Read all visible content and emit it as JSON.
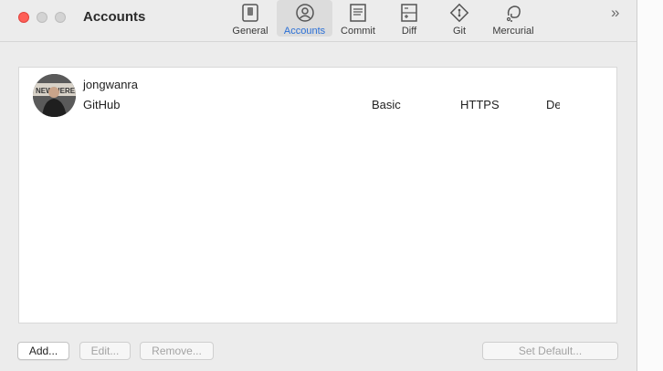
{
  "window": {
    "title": "Accounts"
  },
  "toolbar": {
    "items": [
      {
        "label": "General",
        "icon": "general-switch-icon"
      },
      {
        "label": "Accounts",
        "icon": "account-icon",
        "active": true
      },
      {
        "label": "Commit",
        "icon": "commit-document-icon"
      },
      {
        "label": "Diff",
        "icon": "diff-icon"
      },
      {
        "label": "Git",
        "icon": "git-icon"
      },
      {
        "label": "Mercurial",
        "icon": "mercurial-icon"
      }
    ],
    "overflow": "»"
  },
  "accounts": [
    {
      "username": "jongwanra",
      "service": "GitHub",
      "auth": "Basic",
      "protocol": "HTTPS",
      "default": "De"
    }
  ],
  "buttons": {
    "add": "Add...",
    "edit": "Edit...",
    "remove": "Remove...",
    "set_default": "Set Default..."
  },
  "colors": {
    "accent": "#2a6fd6",
    "close": "#fe5f57"
  }
}
